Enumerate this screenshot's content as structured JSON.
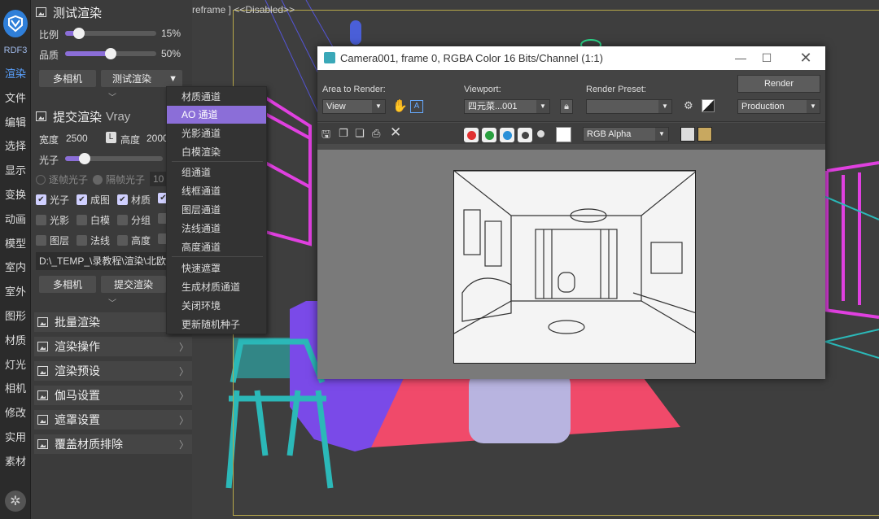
{
  "app": {
    "logo_label": "RDF3"
  },
  "nav": [
    "渲染",
    "文件",
    "编辑",
    "选择",
    "显示",
    "变换",
    "动画",
    "模型",
    "室内",
    "室外",
    "图形",
    "材质",
    "灯光",
    "相机",
    "修改",
    "实用",
    "素材"
  ],
  "test_render": {
    "title": "测试渲染",
    "ratio_label": "比例",
    "ratio_value": "15%",
    "ratio_level": 0.15,
    "quality_label": "品质",
    "quality_value": "50%",
    "quality_level": 0.5,
    "multi_camera": "多相机",
    "test_button": "测试渲染"
  },
  "submit_render": {
    "title": "提交渲染",
    "title_suffix": "Vray",
    "width_label": "宽度",
    "width_value": "2500",
    "lock_label": "L",
    "height_label": "高度",
    "height_value": "2000",
    "photon_label": "光子",
    "photon_level": 0.2,
    "frame_photon": "逐帧光子",
    "interval_photon": "隔帧光子",
    "interval_value": "10",
    "checks": [
      {
        "label": "光子",
        "on": true
      },
      {
        "label": "成图",
        "on": true
      },
      {
        "label": "材质",
        "on": true
      },
      {
        "label": "",
        "on": true
      },
      {
        "label": "光影",
        "on": false
      },
      {
        "label": "白模",
        "on": false
      },
      {
        "label": "分组",
        "on": false
      },
      {
        "label": "",
        "on": false
      },
      {
        "label": "图层",
        "on": false
      },
      {
        "label": "法线",
        "on": false
      },
      {
        "label": "高度",
        "on": false
      },
      {
        "label": "",
        "on": false
      }
    ],
    "path": "D:\\_TEMP_\\录教程\\渲染\\北欧",
    "multi_camera": "多相机",
    "submit_button": "提交渲染"
  },
  "collapsed_sections": [
    "批量渲染",
    "渲染操作",
    "渲染预设",
    "伽马设置",
    "遮罩设置",
    "覆盖材质排除"
  ],
  "menu": {
    "items": [
      "材质通道",
      "AO 通道",
      "光影通道",
      "白模渲染",
      "组通道",
      "线框通道",
      "图层通道",
      "法线通道",
      "高度通道",
      "快速遮罩",
      "生成材质通道",
      "关闭环境",
      "更新随机种子"
    ],
    "highlighted": "AO 通道"
  },
  "viewport": {
    "label": "reframe ] <<Disabled>>"
  },
  "render_window": {
    "title": "Camera001, frame 0, RGBA Color 16 Bits/Channel (1:1)",
    "area_label": "Area to Render:",
    "area_value": "View",
    "viewport_label": "Viewport:",
    "viewport_value": "四元菜...001",
    "preset_label": "Render Preset:",
    "preset_value": "",
    "render_button": "Render",
    "production_value": "Production",
    "channel_value": "RGB Alpha"
  },
  "colors": {
    "accent": "#8b6ed8",
    "logo": "#2f7fd9",
    "magenta": "#e040e0",
    "purple": "#7a4ae8",
    "teal": "#2bb8b8",
    "salmon": "#f04a6a"
  }
}
